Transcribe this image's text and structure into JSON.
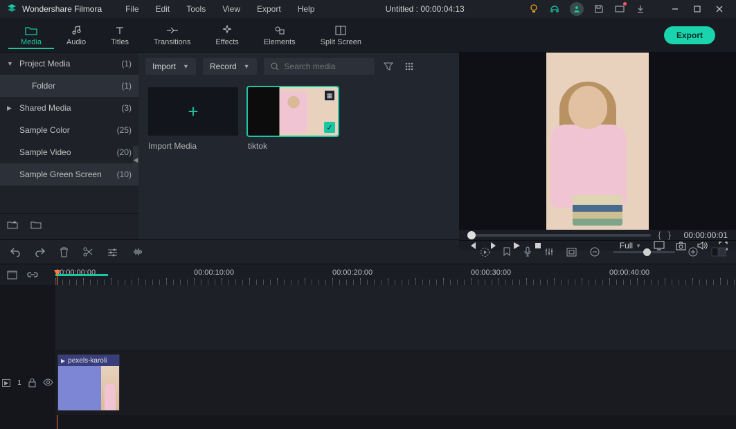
{
  "app": {
    "name": "Wondershare Filmora"
  },
  "menu": {
    "file": "File",
    "edit": "Edit",
    "tools": "Tools",
    "view": "View",
    "export": "Export",
    "help": "Help"
  },
  "title_center": "Untitled : 00:00:04:13",
  "tabs": {
    "media": "Media",
    "audio": "Audio",
    "titles": "Titles",
    "transitions": "Transitions",
    "effects": "Effects",
    "elements": "Elements",
    "split": "Split Screen"
  },
  "export_btn": "Export",
  "sidebar": {
    "project_media": {
      "label": "Project Media",
      "count": "(1)"
    },
    "folder": {
      "label": "Folder",
      "count": "(1)"
    },
    "shared_media": {
      "label": "Shared Media",
      "count": "(3)"
    },
    "sample_color": {
      "label": "Sample Color",
      "count": "(25)"
    },
    "sample_video": {
      "label": "Sample Video",
      "count": "(20)"
    },
    "sample_green": {
      "label": "Sample Green Screen",
      "count": "(10)"
    }
  },
  "media": {
    "import_dd": "Import",
    "record_dd": "Record",
    "search_placeholder": "Search media",
    "import_tile": "Import Media",
    "tiktok": "tiktok"
  },
  "preview": {
    "timecode": "00:00:00:01",
    "quality": "Full"
  },
  "timeline": {
    "marks": [
      "00:00:00:00",
      "00:00:10:00",
      "00:00:20:00",
      "00:00:30:00",
      "00:00:40:00"
    ],
    "clip_name": "pexels-karoli",
    "track_label": "1"
  }
}
